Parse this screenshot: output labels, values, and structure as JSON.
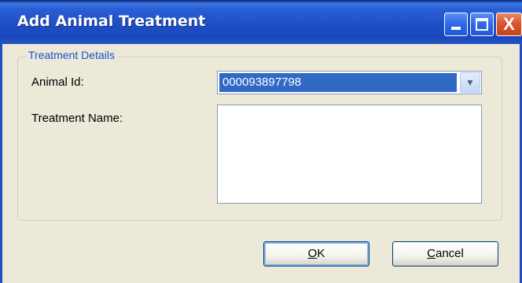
{
  "window": {
    "title": "Add Animal Treatment"
  },
  "titlebar": {
    "minimize_icon": "minimize-icon",
    "maximize_icon": "maximize-icon",
    "close_icon": "close-icon",
    "close_glyph": "X"
  },
  "group": {
    "legend": "Treatment Details"
  },
  "form": {
    "animal_id_label": "Animal Id:",
    "animal_id_value": "000093897798",
    "treatment_name_label": "Treatment Name:",
    "treatment_name_value": ""
  },
  "buttons": {
    "ok_label": "OK",
    "cancel_label": "Cancel"
  },
  "colors": {
    "titlebar": "#1f4fc5",
    "selection": "#316ac5",
    "legend": "#1e4fd0",
    "background": "#ece9d8"
  }
}
